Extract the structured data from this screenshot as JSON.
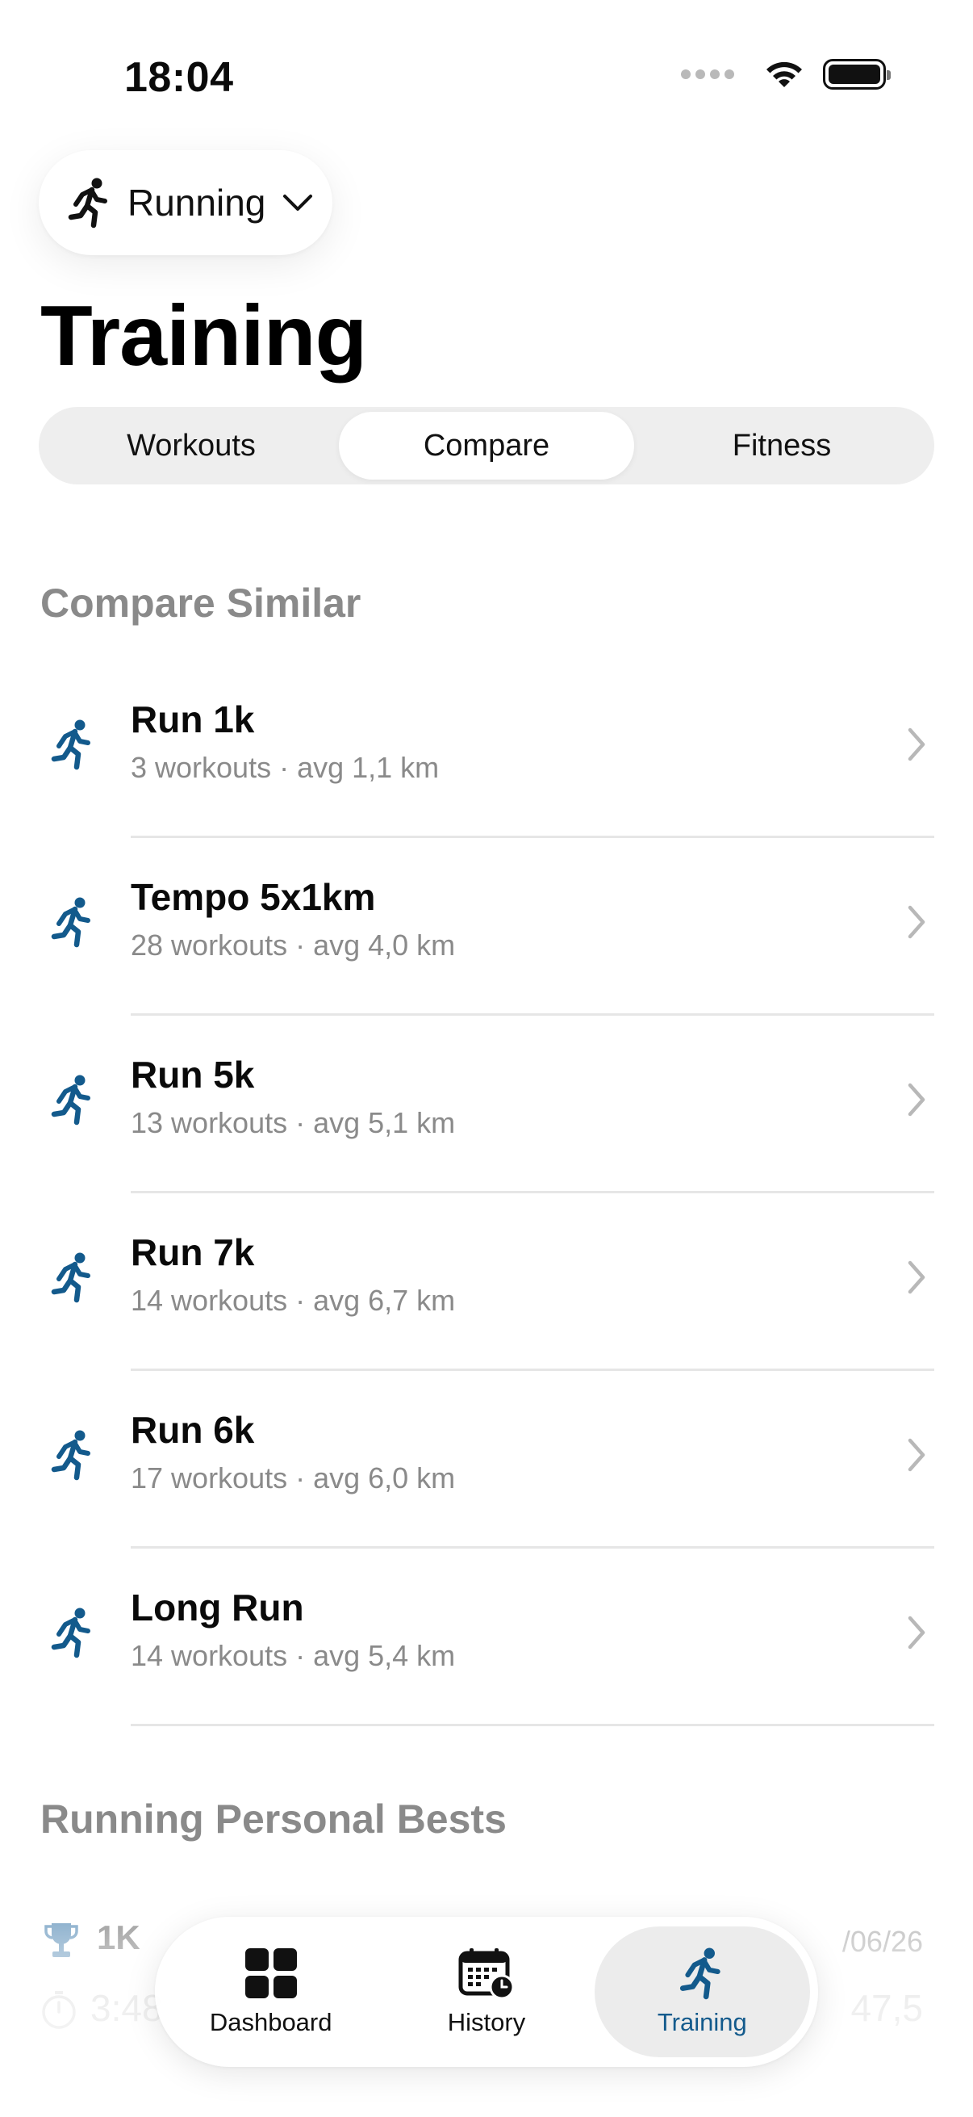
{
  "status_bar": {
    "time": "18:04"
  },
  "sport_selector": {
    "label": "Running",
    "icon": "running-figure-icon"
  },
  "page": {
    "title": "Training"
  },
  "segments": [
    {
      "label": "Workouts",
      "active": false
    },
    {
      "label": "Compare",
      "active": true
    },
    {
      "label": "Fitness",
      "active": false
    }
  ],
  "compare_section": {
    "title": "Compare Similar",
    "items": [
      {
        "name": "Run 1k",
        "meta": "3 workouts · avg 1,1 km"
      },
      {
        "name": "Tempo 5x1km",
        "meta": "28 workouts · avg 4,0 km"
      },
      {
        "name": "Run 5k",
        "meta": "13 workouts · avg 5,1 km"
      },
      {
        "name": "Run 7k",
        "meta": "14 workouts · avg 6,7 km"
      },
      {
        "name": "Run 6k",
        "meta": "17 workouts · avg 6,0 km"
      },
      {
        "name": "Long Run",
        "meta": "14 workouts · avg 5,4 km"
      }
    ]
  },
  "personal_bests": {
    "title": "Running Personal Bests",
    "first": {
      "distance": "1K",
      "date": "/06/26",
      "time": "3:48",
      "pace": "47,5"
    }
  },
  "tabbar": {
    "tabs": [
      {
        "label": "Dashboard",
        "icon": "dashboard-grid-icon",
        "active": false
      },
      {
        "label": "History",
        "icon": "calendar-clock-icon",
        "active": false
      },
      {
        "label": "Training",
        "icon": "running-figure-icon",
        "active": true
      }
    ]
  },
  "colors": {
    "accent": "#135a8c",
    "secondary_text": "#8a8a8a",
    "segment_bg": "#eeeeee"
  }
}
